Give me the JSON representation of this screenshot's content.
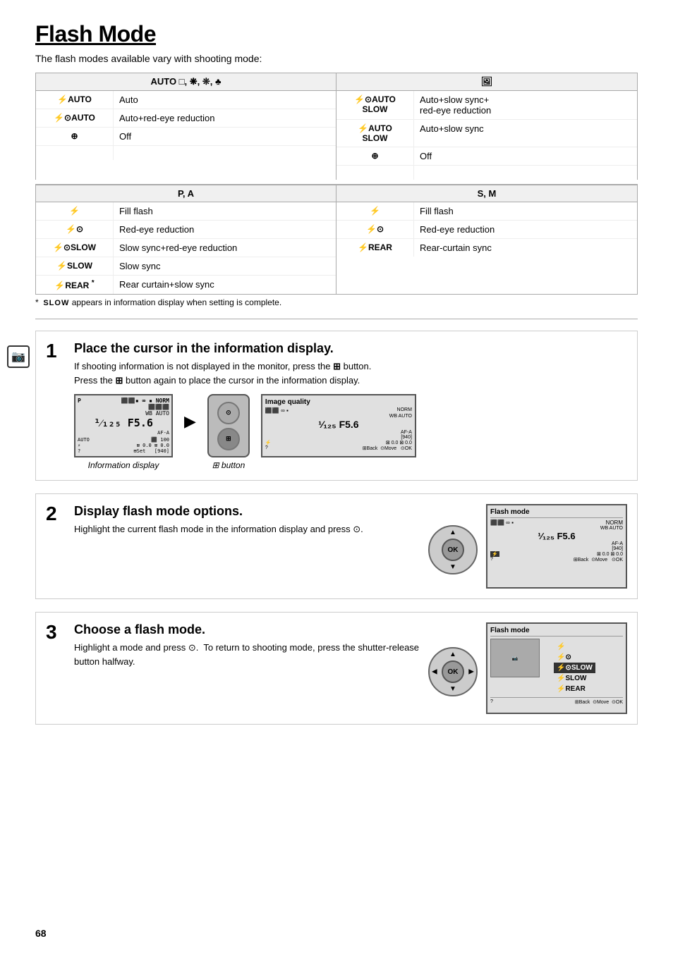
{
  "page": {
    "title": "Flash Mode",
    "subtitle": "The flash modes available vary with shooting mode:",
    "page_number": "68"
  },
  "top_section": {
    "left_header": "AUTO □, ⚡, ⚡, 🌿",
    "left_header_display": "AUTO □, ❋, ❊, ♣",
    "right_header_display": "🖼",
    "left_rows": [
      {
        "icon": "⚡AUTO",
        "desc": "Auto"
      },
      {
        "icon": "⚡🔴AUTO",
        "desc": "Auto+red-eye reduction"
      },
      {
        "icon": "⊘",
        "desc": "Off"
      }
    ],
    "right_rows": [
      {
        "icon": "⚡🔴AUTO SLOW",
        "desc": "Auto+slow sync+red-eye reduction"
      },
      {
        "icon": "⚡AUTO SLOW",
        "desc": "Auto+slow sync"
      },
      {
        "icon": "⊘",
        "desc": "Off"
      }
    ]
  },
  "bottom_section": {
    "left_header": "P, A",
    "right_header": "S, M",
    "left_rows": [
      {
        "icon": "⚡",
        "desc": "Fill flash"
      },
      {
        "icon": "⚡🔴",
        "desc": "Red-eye reduction"
      },
      {
        "icon": "⚡🔴SLOW",
        "desc": "Slow sync+red-eye reduction"
      },
      {
        "icon": "⚡SLOW",
        "desc": "Slow sync"
      },
      {
        "icon": "⚡REAR *",
        "desc": "Rear curtain+slow sync"
      }
    ],
    "right_rows": [
      {
        "icon": "⚡",
        "desc": "Fill flash"
      },
      {
        "icon": "⚡🔴",
        "desc": "Red-eye reduction"
      },
      {
        "icon": "⚡REAR",
        "desc": "Rear-curtain sync"
      }
    ]
  },
  "footnote": "* SLOW appears in information display when setting is complete.",
  "steps": [
    {
      "number": "1",
      "title": "Place the cursor in the information display.",
      "desc": "If shooting information is not displayed in the monitor, press the ⊞ button. Press the ⊞ button again to place the cursor in the information display.",
      "captions": [
        "Information display",
        "⊞ button"
      ]
    },
    {
      "number": "2",
      "title": "Display flash mode options.",
      "desc": "Highlight the current flash mode in the information display and press ⊙.",
      "screen_title": "Flash mode"
    },
    {
      "number": "3",
      "title": "Choose a flash mode.",
      "desc": "Highlight a mode and press ⊙.  To return to shooting mode, press the shutter-release button halfway.",
      "screen_title": "Flash mode",
      "modes": [
        "⚡",
        "⚡🔴",
        "⚡🔴SLOW",
        "⚡SLOW",
        "⚡REAR"
      ]
    }
  ]
}
